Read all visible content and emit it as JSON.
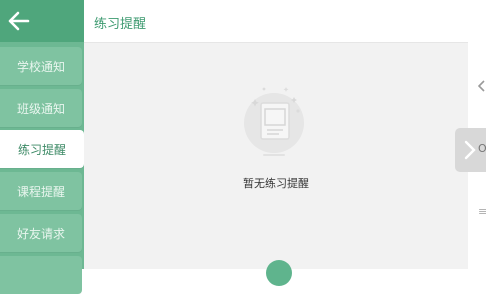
{
  "sidebar": {
    "back_icon": "arrow-left-icon",
    "items": [
      {
        "label": "学校通知",
        "active": false
      },
      {
        "label": "班级通知",
        "active": false
      },
      {
        "label": "练习提醒",
        "active": true
      },
      {
        "label": "课程提醒",
        "active": false
      },
      {
        "label": "好友请求",
        "active": false
      }
    ]
  },
  "header": {
    "title": "练习提醒"
  },
  "main": {
    "empty_icon": "empty-document-icon",
    "empty_text": "暂无练习提醒"
  },
  "edge": {
    "left_chevron_icon": "chevron-left-icon",
    "tab_chevron_icon": "chevron-right-icon",
    "tab_label": "O",
    "menu_icon": "menu-icon",
    "menu_glyph": "≡"
  },
  "colors": {
    "sidebar_bg": "#6db893",
    "nav_item_bg": "#7fc3a1",
    "back_button_bg": "#4fa67c",
    "accent_text": "#3d9a70",
    "content_bg": "#f2f2f2"
  }
}
